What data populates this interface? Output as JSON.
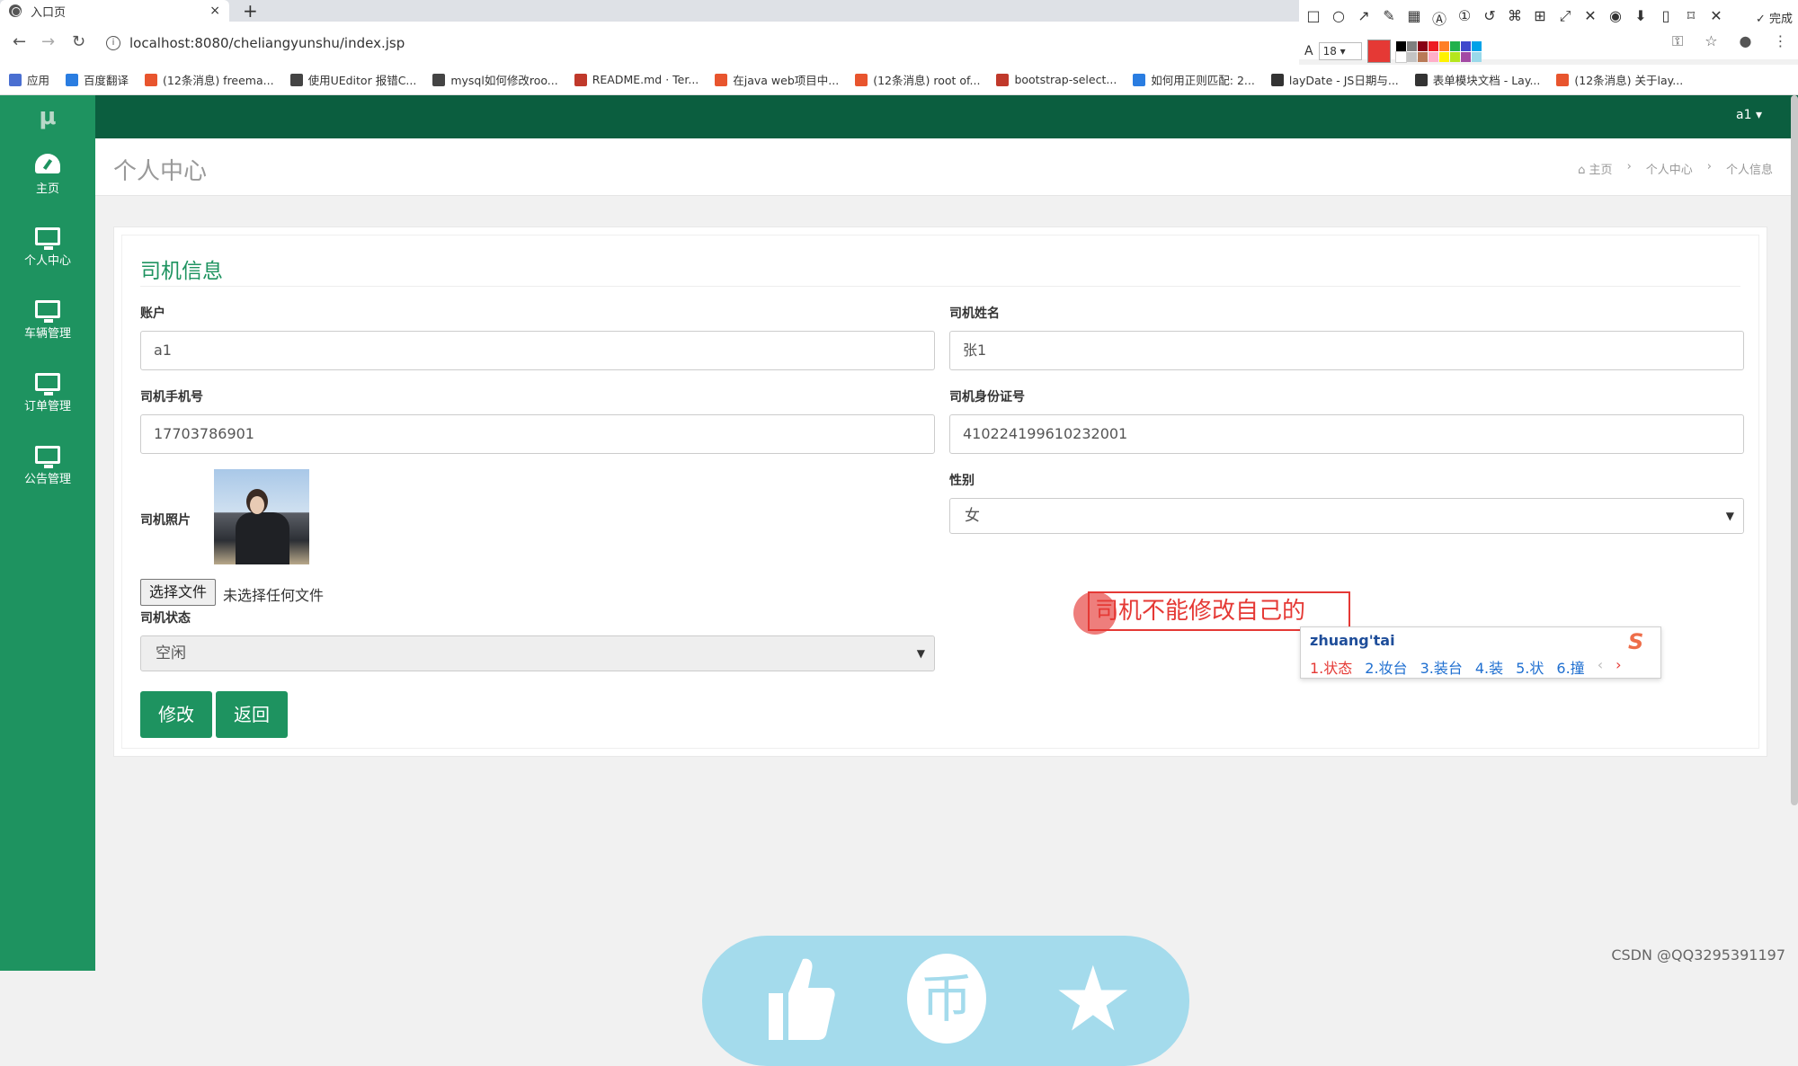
{
  "browser": {
    "tab_title": "入口页",
    "tab_close": "×",
    "new_tab": "+",
    "url": "localhost:8080/cheliangyunshu/index.jsp",
    "font_size": "18",
    "done_label": "完成",
    "bookmarks": [
      {
        "label": "应用",
        "color": "#4a6fd1"
      },
      {
        "label": "百度翻译",
        "color": "#2a7de1"
      },
      {
        "label": "(12条消息) freema...",
        "color": "#e8552e"
      },
      {
        "label": "使用UEditor 报错C...",
        "color": "#444444"
      },
      {
        "label": "mysql如何修改roo...",
        "color": "#444444"
      },
      {
        "label": "README.md · Ter...",
        "color": "#c0392b"
      },
      {
        "label": "在java web项目中...",
        "color": "#e8552e"
      },
      {
        "label": "(12条消息) root of...",
        "color": "#e8552e"
      },
      {
        "label": "bootstrap-select...",
        "color": "#c0392b"
      },
      {
        "label": "如何用正则匹配: 2...",
        "color": "#2a7de1"
      },
      {
        "label": "layDate - JS日期与...",
        "color": "#333333"
      },
      {
        "label": "表单模块文档 - Lay...",
        "color": "#333333"
      },
      {
        "label": "(12条消息) 关于lay...",
        "color": "#e8552e"
      }
    ]
  },
  "app": {
    "logo": "μ",
    "user": "a1 ▾",
    "sidebar": [
      {
        "label": "主页",
        "icon": "dashboard-icon"
      },
      {
        "label": "个人中心",
        "icon": "monitor-icon"
      },
      {
        "label": "车辆管理",
        "icon": "monitor-icon"
      },
      {
        "label": "订单管理",
        "icon": "monitor-icon"
      },
      {
        "label": "公告管理",
        "icon": "monitor-icon"
      }
    ],
    "page_title": "个人中心",
    "breadcrumb": [
      "主页",
      "个人中心",
      "个人信息"
    ],
    "breadcrumb_sep": "›"
  },
  "form": {
    "section_title": "司机信息",
    "account_label": "账户",
    "account_value": "a1",
    "name_label": "司机姓名",
    "name_value": "张1",
    "phone_label": "司机手机号",
    "phone_value": "17703786901",
    "idcard_label": "司机身份证号",
    "idcard_value": "410224199610232001",
    "photo_label": "司机照片",
    "file_button": "选择文件",
    "file_status": "未选择任何文件",
    "gender_label": "性别",
    "gender_value": "女",
    "status_label": "司机状态",
    "status_value": "空闲",
    "submit_button": "修改",
    "back_button": "返回"
  },
  "annotation": {
    "text": "司机不能修改自己的",
    "ime_pinyin": "zhuang'tai",
    "ime_candidates": [
      "1.状态",
      "2.妆台",
      "3.装台",
      "4.装",
      "5.状",
      "6.撞"
    ],
    "ime_logo": "S"
  },
  "floatbar": {
    "center_glyph": "币"
  },
  "watermark": "CSDN @QQ3295391197",
  "colors": {
    "sidebar": "#1e9360",
    "topnav": "#0b5e3f",
    "accent": "#1e9360",
    "annotation": "#e53935",
    "floatbar": "#a4dbec"
  }
}
